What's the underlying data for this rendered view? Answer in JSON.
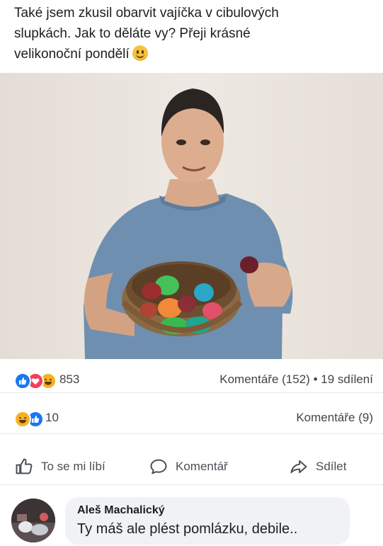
{
  "post": {
    "text_line1": "Také jsem zkusil obarvit vajíčka v cibulových",
    "text_line2": "slupkách. Jak to děláte vy? Přeji krásné",
    "text_line3": "velikonoční pondělí",
    "emoji": "smiling-face-emoji"
  },
  "stats_primary": {
    "reaction_icons": [
      "like-reaction-icon",
      "love-reaction-icon",
      "haha-reaction-icon"
    ],
    "reaction_count": "853",
    "comments": "Komentáře (152)",
    "separator": "•",
    "shares": "19 sdílení"
  },
  "stats_secondary": {
    "reaction_icons": [
      "haha-reaction-icon",
      "like-reaction-icon"
    ],
    "reaction_count": "10",
    "comments": "Komentáře (9)"
  },
  "actions": {
    "like": "To se mi líbí",
    "comment": "Komentář",
    "share": "Sdílet"
  },
  "comment": {
    "author": "Aleš Machalický",
    "text": "Ty máš ale plést pomlázku, debile.."
  },
  "colors": {
    "like_blue": "#1877f2",
    "love_red": "#f33e58",
    "haha_yellow": "#f7b125",
    "text_dark": "#1c1e21",
    "text_gray": "#4b4f56",
    "bubble_bg": "#f0f2f5"
  }
}
